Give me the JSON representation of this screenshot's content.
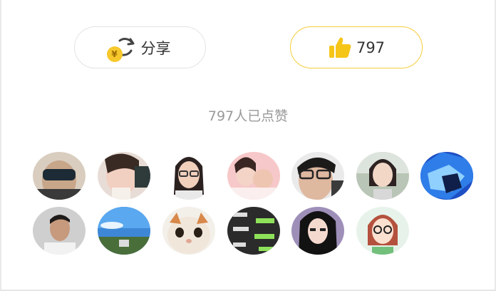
{
  "share_button": {
    "label": "分享",
    "coin_symbol": "¥",
    "icon": "share-refresh-icon"
  },
  "like_button": {
    "count": "797",
    "icon": "thumbs-up-icon",
    "accent": "#f5cd3a"
  },
  "likes_summary": "797人已点赞",
  "avatars": [
    {
      "name": "avatar-user-1",
      "desc": "man wearing dark sunglasses"
    },
    {
      "name": "avatar-user-2",
      "desc": "woman resting face on hand"
    },
    {
      "name": "avatar-user-3",
      "desc": "woman with glasses"
    },
    {
      "name": "avatar-user-4",
      "desc": "woman holding baby"
    },
    {
      "name": "avatar-user-5",
      "desc": "man with glasses selfie"
    },
    {
      "name": "avatar-user-6",
      "desc": "woman outdoor portrait"
    },
    {
      "name": "avatar-user-7",
      "desc": "blue abstract cat art"
    },
    {
      "name": "avatar-user-8",
      "desc": "man portrait grey background"
    },
    {
      "name": "avatar-user-9",
      "desc": "blue sky landscape"
    },
    {
      "name": "avatar-user-10",
      "desc": "fluffy exotic cat"
    },
    {
      "name": "avatar-user-11",
      "desc": "chat screenshot"
    },
    {
      "name": "avatar-user-12",
      "desc": "long-haired girl"
    },
    {
      "name": "avatar-user-13",
      "desc": "cartoon girl with glasses"
    }
  ],
  "colors": {
    "accent_yellow": "#f5cd3a",
    "muted_text": "#999999",
    "border_grey": "#e3e3e3"
  }
}
